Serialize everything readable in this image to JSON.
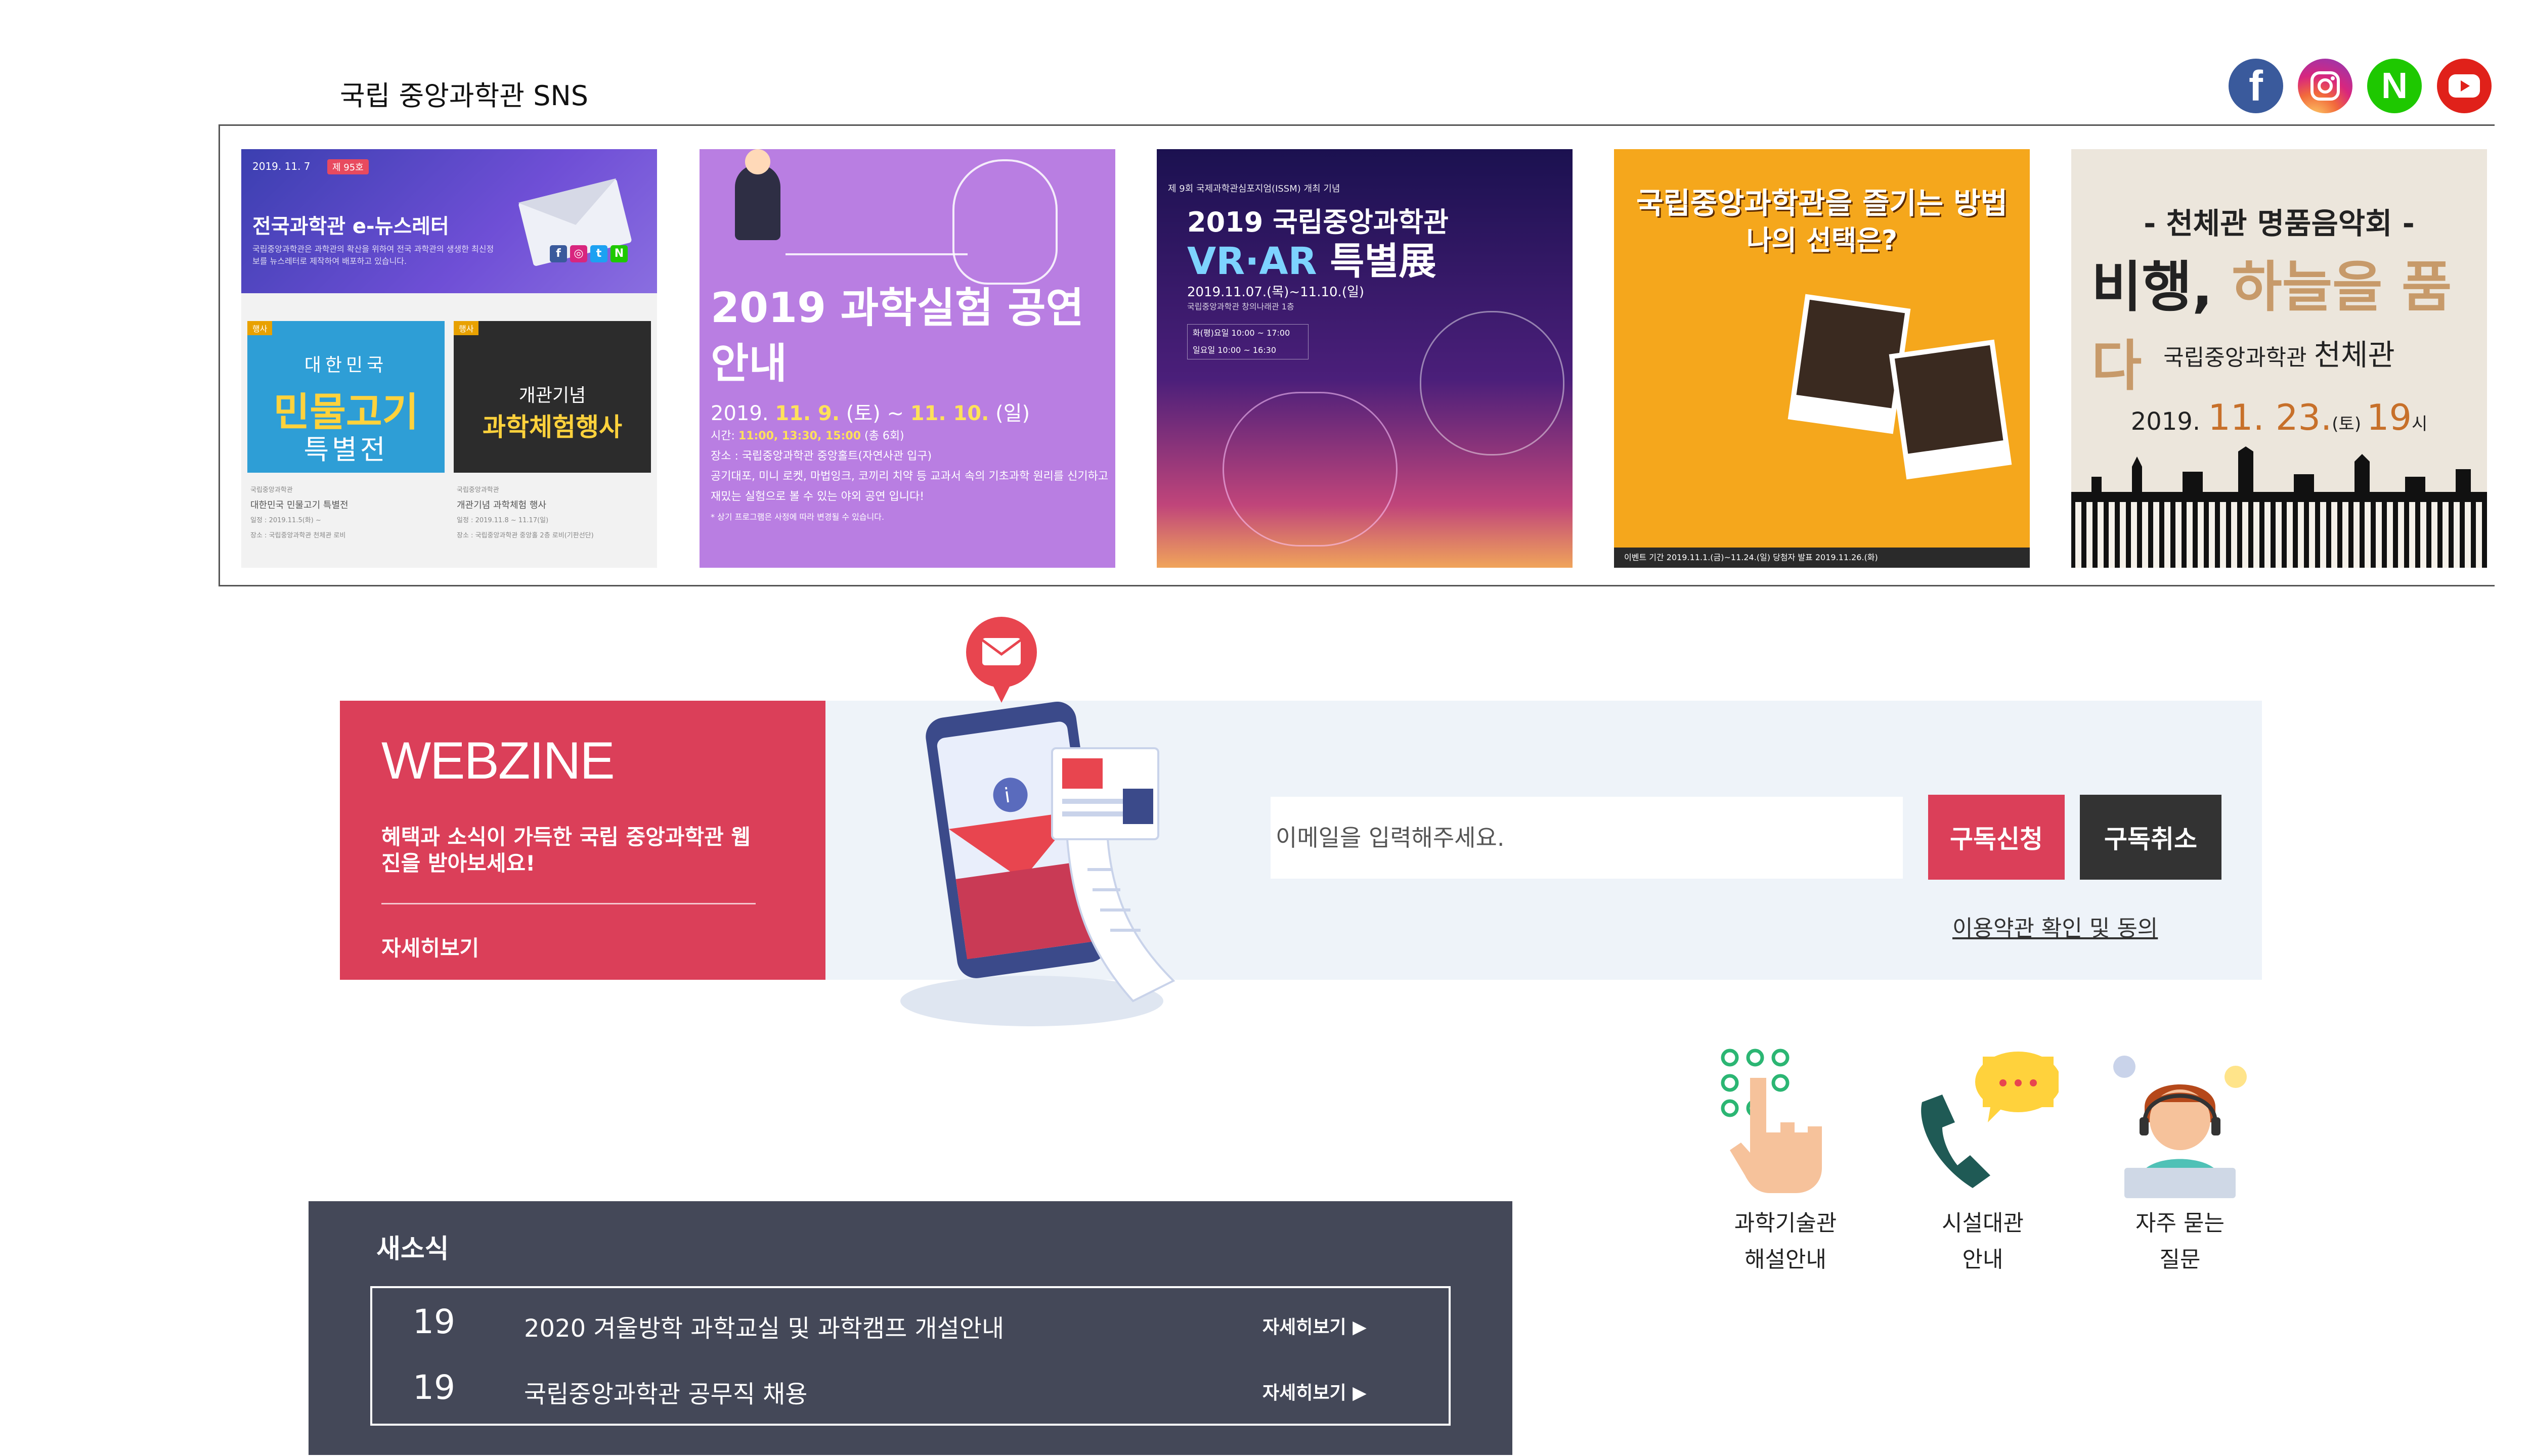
{
  "sns": {
    "title": "국립 중앙과학관 SNS",
    "icons": [
      {
        "name": "facebook-icon",
        "label": "f",
        "color": "#3a5a9c"
      },
      {
        "name": "instagram-icon",
        "label": "",
        "color": "#d8267e"
      },
      {
        "name": "naver-icon",
        "label": "N",
        "color": "#1ec800"
      },
      {
        "name": "youtube-icon",
        "label": "",
        "color": "#e0211a"
      }
    ],
    "cards": [
      {
        "date": "2019. 11. 7",
        "tag": "제 95호",
        "title": "전국과학관 e-뉴스레터",
        "subtitle": "국립중앙과학관은 과학관의 확산을 위하여 전국 과학관의 생생한 최신정보를 뉴스레터로 제작하여 배포하고 있습니다.",
        "poster1": {
          "badge": "행사",
          "line1": "대한민국",
          "line2": "민물고기",
          "line3": "특별전"
        },
        "poster2": {
          "badge": "행사",
          "line1": "개관기념",
          "line2": "과학체험행사"
        },
        "caption1": {
          "org": "국립중앙과학관",
          "title": "대한민국 민물고기 특별전",
          "date": "일정 : 2019.11.5(화) ~",
          "place": "장소 : 국립중앙과학관 천체관 로비"
        },
        "caption2": {
          "org": "국립중앙과학관",
          "title": "개관기념 과학체험 행사",
          "date": "일정 : 2019.11.8 ~ 11.17(일)",
          "place": "장소 : 국립중앙과학관 중앙홀 2층 로비(기판선단)"
        }
      },
      {
        "title": "2019 과학실험 공연안내",
        "date_prefix": "2019. ",
        "date_hl": "11. 9.",
        "date_mid": " (토) ~ ",
        "date_hl2": "11. 10.",
        "date_suffix": " (일)",
        "time_label": "시간: ",
        "time": "11:00, 13:30, 15:00",
        "time_suffix": " (총 6회)",
        "place": "장소 : 국립중앙과학관 중앙홀트(자연사관 입구)",
        "desc": "공기대포, 미니 로켓, 마법잉크, 코끼리 치약 등 교과서 속의 기초과학 원리를 신기하고 재밌는 실험으로 볼 수 있는 야외 공연 입니다!",
        "note": "* 상기 프로그램은 사정에 따라 변경될 수 있습니다."
      },
      {
        "top": "제 9회 국제과학관심포지엄(ISSM) 개최 기념",
        "line1": "2019 국립중앙과학관",
        "line2a": "VR·AR",
        "line2b": " 특별展",
        "date": "2019.11.07.(목)~11.10.(일)",
        "place": "국립중앙과학관 창의나래관 1층",
        "hours1": "화(평)요일 10:00 ~ 17:00",
        "hours2": "일요일 10:00 ~ 16:30"
      },
      {
        "line1": "국립중앙과학관을 즐기는 방법",
        "line2": "나의 선택은?",
        "period": "이벤트 기간  2019.11.1.(금)~11.24.(일)   당첨자 발표  2019.11.26.(화)"
      },
      {
        "line0": "- 천체관 명품음악회 -",
        "line1a": "비행, ",
        "line1b": "하늘을 품다",
        "line2a": "국립중앙과학관 ",
        "line2b": "천체관",
        "date_a": "2019. ",
        "date_b": "11. 23.",
        "date_c": "(토) ",
        "date_d": "19",
        "date_e": "시"
      }
    ]
  },
  "webzine": {
    "title": "WEBZINE",
    "desc": "혜택과 소식이 가득한 국립 중앙과학관 웹진을 받아보세요!",
    "more": "자세히보기",
    "email_placeholder": "이메일을 입력해주세요.",
    "subscribe": "구독신청",
    "unsubscribe": "구독취소",
    "terms": "이용약관 확인 및 동의"
  },
  "quick_links": [
    {
      "line1": "과학기술관",
      "line2": "해설안내",
      "icon": "touch-hand-icon"
    },
    {
      "line1": "시설대관",
      "line2": "안내",
      "icon": "phone-chat-icon"
    },
    {
      "line1": "자주 묻는",
      "line2": "질문",
      "icon": "support-agent-icon"
    }
  ],
  "news": {
    "title": "새소식",
    "items": [
      {
        "day": "19",
        "text": "2020 겨울방학 과학교실 및 과학캠프 개설안내",
        "more": "자세히보기 ▶"
      },
      {
        "day": "19",
        "text": "국립중앙과학관 공무직 채용",
        "more": "자세히보기 ▶"
      }
    ]
  },
  "colors": {
    "accent": "#db3f59",
    "dark_button": "#333333",
    "news_bg": "#444858",
    "webzine_band": "#eef3f9"
  }
}
